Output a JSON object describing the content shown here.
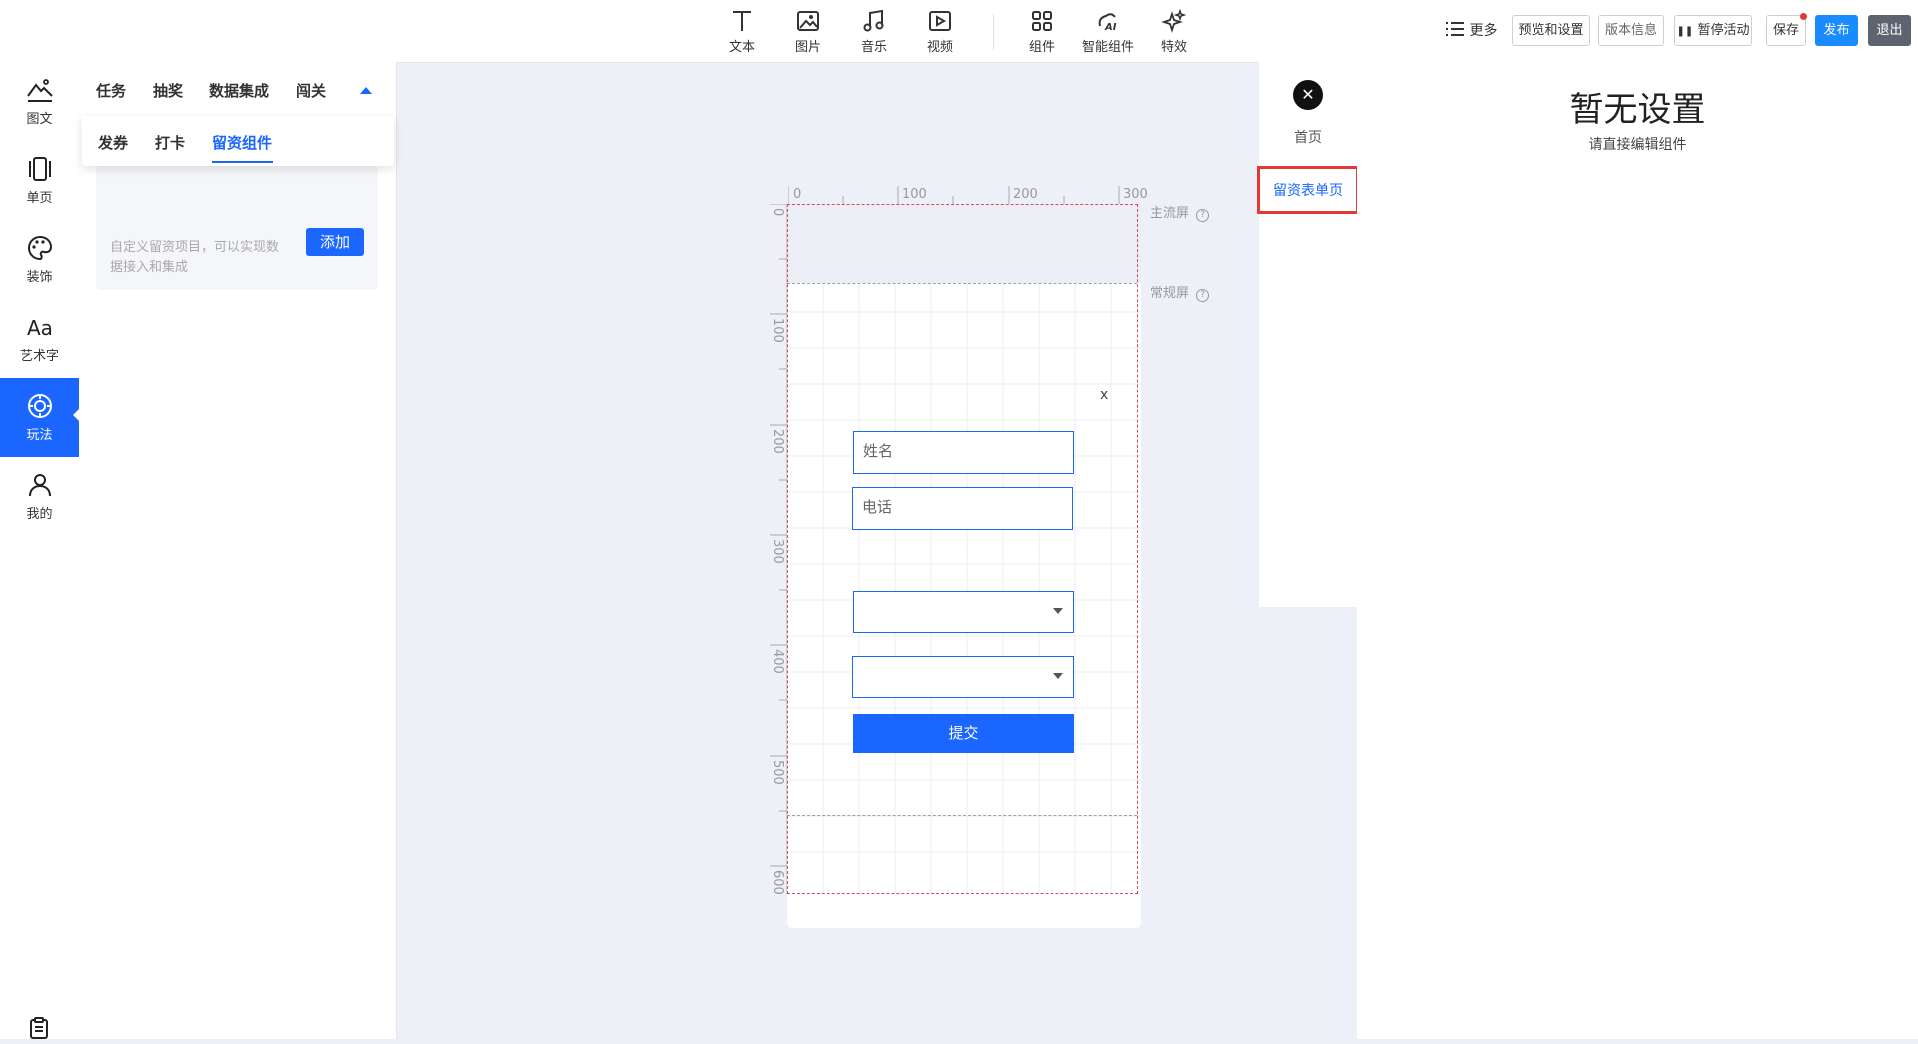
{
  "toolbar": {
    "tools": [
      {
        "label": "文本",
        "icon": "text-icon"
      },
      {
        "label": "图片",
        "icon": "image-icon"
      },
      {
        "label": "音乐",
        "icon": "music-icon"
      },
      {
        "label": "视频",
        "icon": "video-icon"
      },
      {
        "label": "组件",
        "icon": "components-icon"
      },
      {
        "label": "智能组件",
        "icon": "ai-icon"
      },
      {
        "label": "特效",
        "icon": "sparkle-icon"
      }
    ],
    "more": "更多",
    "preview": "预览和设置",
    "version": "版本信息",
    "pause": "暂停活动",
    "save": "保存",
    "publish": "发布",
    "exit": "退出"
  },
  "rail": [
    {
      "label": "图文",
      "icon": "image-text-icon"
    },
    {
      "label": "单页",
      "icon": "single-page-icon"
    },
    {
      "label": "装饰",
      "icon": "palette-icon"
    },
    {
      "label": "艺术字",
      "icon": "art-text-icon"
    },
    {
      "label": "玩法",
      "icon": "gameplay-icon",
      "active": true
    },
    {
      "label": "我的",
      "icon": "user-icon"
    }
  ],
  "panel": {
    "categories": [
      "任务",
      "抽奖",
      "数据集成",
      "闯关"
    ],
    "subtabs": [
      "发券",
      "打卡",
      "留资组件"
    ],
    "card_desc": "自定义留资项目，可以实现数据接入和集成",
    "add_label": "添加"
  },
  "canvas": {
    "ruler_top": [
      "0",
      "100",
      "200",
      "300"
    ],
    "ruler_left": [
      "0",
      "100",
      "200",
      "300",
      "400",
      "500",
      "600"
    ],
    "main_screen": "主流屏",
    "normal_screen": "常规屏",
    "close_x": "x",
    "name_placeholder": "姓名",
    "phone_placeholder": "电话",
    "submit": "提交"
  },
  "pages": {
    "home": "首页",
    "form_page": "留资表单页"
  },
  "settings": {
    "title": "暂无设置",
    "subtitle": "请直接编辑组件"
  },
  "colors": {
    "accent": "#1a66ff",
    "highlight": "#e53935"
  }
}
